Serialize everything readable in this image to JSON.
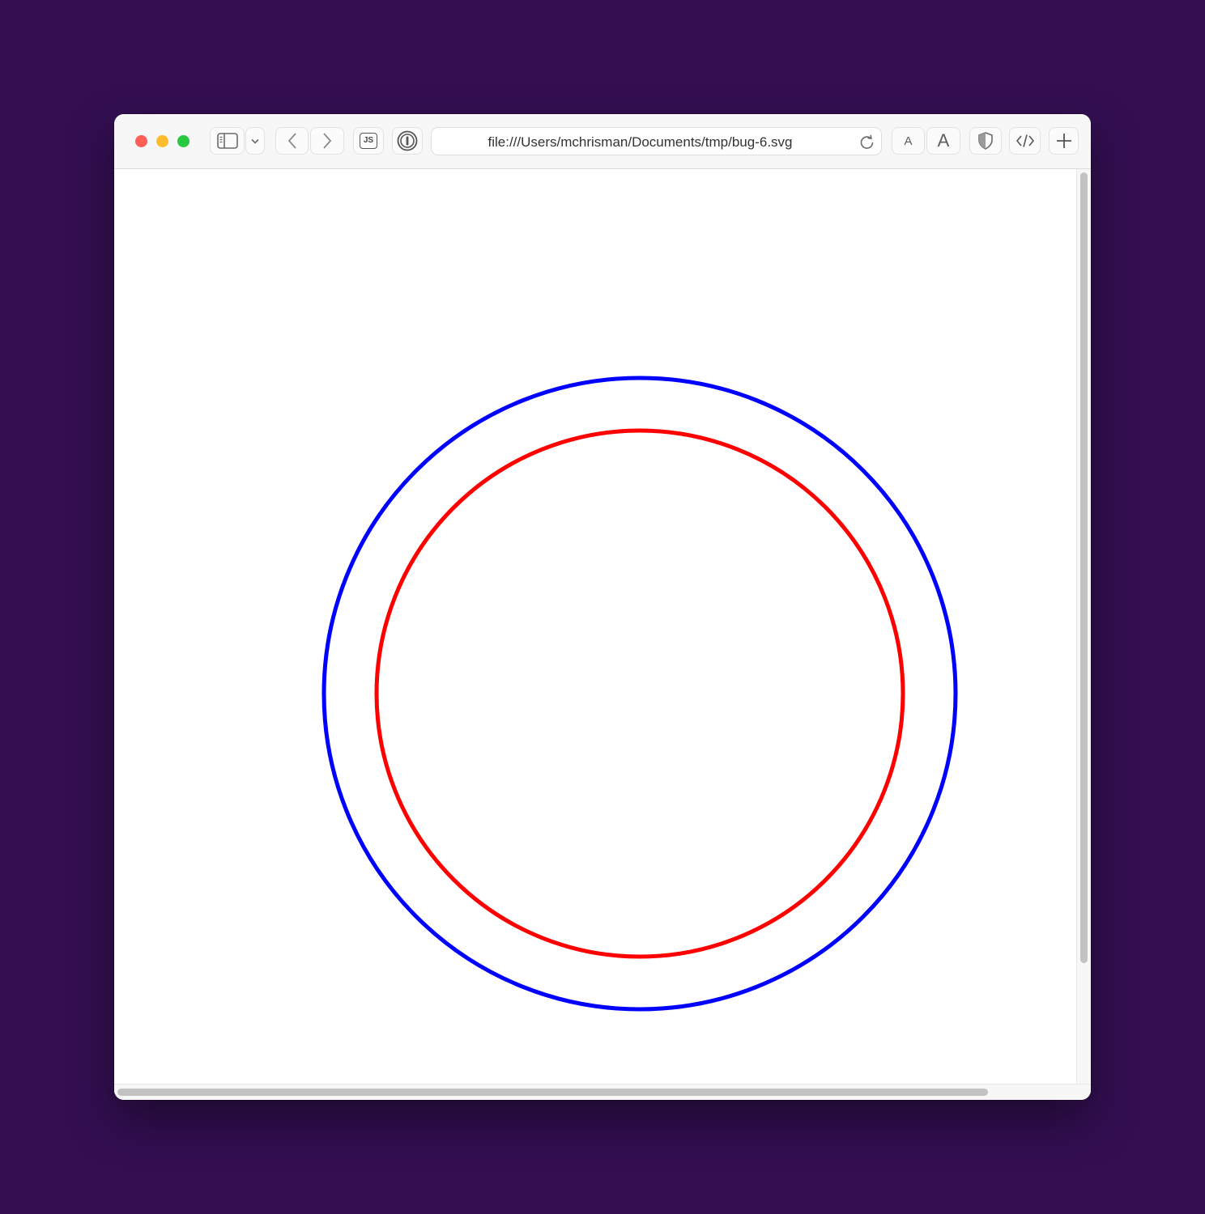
{
  "browser": {
    "address_bar": {
      "url": "file:///Users/mchrisman/Documents/tmp/bug-6.svg"
    },
    "toolbar": {
      "js_label": "JS",
      "font_smaller_label": "A",
      "font_larger_label": "A",
      "icons": [
        "sidebar-icon",
        "chevron-down-icon",
        "back-icon",
        "forward-icon",
        "js-icon",
        "password-manager-icon",
        "reload-icon",
        "shield-icon",
        "code-icon",
        "plus-icon"
      ]
    },
    "traffic_lights": {
      "close": "#fe5f57",
      "minimize": "#febc2e",
      "zoom": "#28c840"
    }
  },
  "svg_document": {
    "circles": [
      {
        "stroke": "#0000ff",
        "fill": "none"
      },
      {
        "stroke": "#ff0000",
        "fill": "none"
      }
    ]
  },
  "colors": {
    "desktop_background": "#330f52"
  }
}
